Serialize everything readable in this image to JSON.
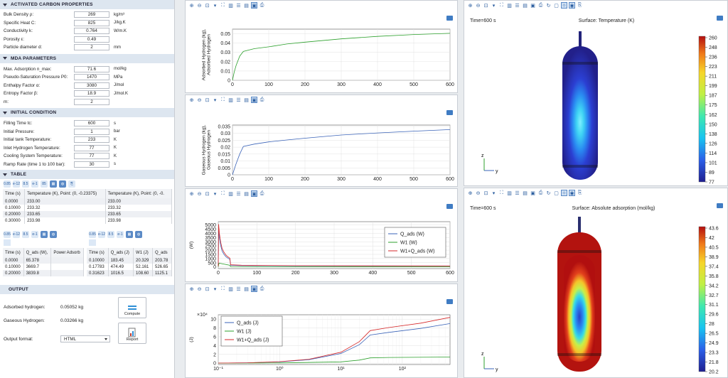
{
  "sections": {
    "carbon": {
      "title": "ACTIVATED CARBON PROPERTIES",
      "rows": [
        {
          "label": "Bulk Density ρ:",
          "value": "269",
          "unit": "kg/m³"
        },
        {
          "label": "Specific Heat C:",
          "value": "825",
          "unit": "J/kg.K"
        },
        {
          "label": "Conductivity k:",
          "value": "0.764",
          "unit": "W/m.K"
        },
        {
          "label": "Porosity ε:",
          "value": "0.49",
          "unit": ""
        },
        {
          "label": "Particle diameter d:",
          "value": "2",
          "unit": "mm"
        }
      ]
    },
    "mda": {
      "title": "MDA PARAMETERS",
      "rows": [
        {
          "label": "Max. Adsorption n_max:",
          "value": "71.6",
          "unit": "mol/kg"
        },
        {
          "label": "Pseudo-Saturation Pressure P0:",
          "value": "1470",
          "unit": "MPa"
        },
        {
          "label": "Enthalpy Factor α:",
          "value": "3080",
          "unit": "J/mol"
        },
        {
          "label": "Entropy Factor β:",
          "value": "18.9",
          "unit": "J/mol.K"
        },
        {
          "label": "m:",
          "value": "2",
          "unit": ""
        }
      ]
    },
    "initial": {
      "title": "INITIAL CONDITION",
      "rows": [
        {
          "label": "Filling Time tc:",
          "value": "600",
          "unit": "s"
        },
        {
          "label": "Initial Pressure:",
          "value": "1",
          "unit": "bar"
        },
        {
          "label": "Initial tank Temperature:",
          "value": "233",
          "unit": "K"
        },
        {
          "label": "Inlet Hydrogen Temperature:",
          "value": "77",
          "unit": "K"
        },
        {
          "label": "Cooling System Temperature:",
          "value": "77",
          "unit": "K"
        },
        {
          "label": "Ramp Rate (time 1 to 100 bar):",
          "value": "30",
          "unit": "s"
        }
      ]
    },
    "table": {
      "title": "TABLE"
    },
    "output": {
      "title": "OUTPUT"
    }
  },
  "table1": {
    "headers": [
      "Time (s)",
      "Temperature (K), Point: (0, -0.23375)",
      "Temperature (K), Point: (0, -0."
    ],
    "rows": [
      [
        "0.0000",
        "233.00",
        "233.00"
      ],
      [
        "0.10000",
        "233.32",
        "233.32"
      ],
      [
        "0.20000",
        "233.65",
        "233.65"
      ],
      [
        "0.30000",
        "233.98",
        "233.98"
      ]
    ]
  },
  "table2": {
    "headers": [
      "Time (s)",
      "Q_ads (W),",
      "Power Adsorb"
    ],
    "rows": [
      [
        "0.0000",
        "65.378",
        ""
      ],
      [
        "0.10000",
        "3669.7",
        ""
      ],
      [
        "0.20000",
        "3839.8",
        ""
      ]
    ]
  },
  "table3": {
    "headers": [
      "Time (s)",
      "Q_ads (J)",
      "W1 (J)",
      "Q_ads"
    ],
    "rows": [
      [
        "0.10000",
        "183.45",
        "20.329",
        "203.78"
      ],
      [
        "0.17783",
        "474.49",
        "52.161",
        "526.65"
      ],
      [
        "0.31623",
        "1016.5",
        "108.60",
        "1125.1"
      ]
    ]
  },
  "toolbar_glyphs": {
    "small_a": "0.85",
    "small_b": "e-12",
    "small_c": "8.5",
    "small_d": "e-1",
    "small_e": "85"
  },
  "output": {
    "adsorbed_label": "Adsorbed hydrogen:",
    "adsorbed_value": "0.05052 kg",
    "gaseous_label": "Gaseous Hydrogen:",
    "gaseous_value": "0.03266 kg",
    "compute_label": "Compute",
    "report_label": "Report",
    "format_label": "Output format:",
    "format_value": "HTML"
  },
  "chart_data": [
    {
      "type": "line",
      "ylabel": "Adsorbed Hydrogen (kg), Adsorbed Hydrogen",
      "xlim": [
        0,
        600
      ],
      "ylim": [
        0,
        0.055
      ],
      "xticks": [
        0,
        100,
        200,
        300,
        400,
        500,
        600
      ],
      "yticks": [
        0,
        0.01,
        0.02,
        0.03,
        0.04,
        0.05
      ],
      "series": [
        {
          "color": "#2ca02c",
          "x": [
            0,
            5,
            10,
            20,
            30,
            60,
            100,
            150,
            200,
            300,
            400,
            500,
            600
          ],
          "y": [
            0,
            0.009,
            0.016,
            0.026,
            0.031,
            0.034,
            0.036,
            0.039,
            0.041,
            0.0445,
            0.0472,
            0.0492,
            0.0505
          ]
        }
      ]
    },
    {
      "type": "line",
      "ylabel": "Gaseous Hydrogen (kg), Gaseous Hydrogen",
      "xlim": [
        0,
        600
      ],
      "ylim": [
        0,
        0.036
      ],
      "xticks": [
        0,
        100,
        200,
        300,
        400,
        500,
        600
      ],
      "yticks": [
        0,
        0.005,
        0.01,
        0.015,
        0.02,
        0.025,
        0.03,
        0.035
      ],
      "series": [
        {
          "color": "#3a63b8",
          "x": [
            0,
            5,
            10,
            20,
            30,
            60,
            100,
            150,
            200,
            300,
            400,
            500,
            600
          ],
          "y": [
            0,
            0.004,
            0.008,
            0.015,
            0.0205,
            0.0222,
            0.0238,
            0.0252,
            0.0265,
            0.0288,
            0.0303,
            0.0316,
            0.0327
          ]
        }
      ]
    },
    {
      "type": "line",
      "ylabel": "(W)",
      "xlim": [
        0,
        600
      ],
      "ylim": [
        -200,
        5400
      ],
      "xticks": [
        0,
        100,
        200,
        300,
        400,
        500,
        600
      ],
      "yticks": [
        0,
        500,
        1000,
        1500,
        2000,
        2500,
        3000,
        3500,
        4000,
        4500,
        5000
      ],
      "legend": "top-right",
      "series": [
        {
          "name": "Q_ads (W)",
          "color": "#3a63b8",
          "x": [
            0,
            1,
            3,
            6,
            10,
            15,
            20,
            25,
            30,
            32,
            60,
            200,
            600
          ],
          "y": [
            65,
            4300,
            3500,
            2600,
            1900,
            1500,
            1200,
            1050,
            900,
            200,
            160,
            120,
            100
          ]
        },
        {
          "name": "W1 (W)",
          "color": "#2ca02c",
          "x": [
            0,
            2,
            30,
            32,
            100,
            600
          ],
          "y": [
            0,
            450,
            200,
            20,
            10,
            5
          ]
        },
        {
          "name": "W1+Q_ads (W)",
          "color": "#d62728",
          "x": [
            0,
            1,
            3,
            6,
            10,
            15,
            20,
            25,
            30,
            32,
            60,
            200,
            600
          ],
          "y": [
            80,
            5100,
            4000,
            3000,
            2200,
            1750,
            1400,
            1200,
            1050,
            250,
            200,
            150,
            110
          ]
        }
      ]
    },
    {
      "type": "line",
      "ylabel": "(J)",
      "xscale": "log",
      "xlim": [
        0.1,
        600
      ],
      "ylim": [
        -0.3,
        11
      ],
      "xticks": [
        0.1,
        1,
        10,
        100
      ],
      "xtick_labels": [
        "10⁻¹",
        "10⁰",
        "10¹",
        "10²"
      ],
      "yticks": [
        0,
        2,
        4,
        6,
        8,
        10
      ],
      "y_multiplier": "×10⁴",
      "legend": "top-left",
      "series": [
        {
          "name": "Q_ads (J)",
          "color": "#3a63b8",
          "x": [
            0.1,
            0.3,
            1,
            3,
            10,
            20,
            30,
            60,
            200,
            600
          ],
          "y": [
            0.02,
            0.08,
            0.3,
            0.8,
            2.2,
            4.2,
            6.4,
            7.0,
            7.9,
            9.0
          ]
        },
        {
          "name": "W1 (J)",
          "color": "#2ca02c",
          "x": [
            0.1,
            1,
            10,
            20,
            30,
            60,
            600
          ],
          "y": [
            0,
            0.05,
            0.3,
            0.7,
            1.2,
            1.3,
            1.4
          ]
        },
        {
          "name": "W1+Q_ads (J)",
          "color": "#d62728",
          "x": [
            0.1,
            0.3,
            1,
            3,
            10,
            20,
            30,
            60,
            200,
            600
          ],
          "y": [
            0.02,
            0.09,
            0.35,
            0.9,
            2.5,
            4.9,
            7.4,
            8.1,
            9.1,
            10.4
          ]
        }
      ]
    }
  ],
  "surface_temp": {
    "time": "Time=600 s",
    "title": "Surface: Temperature (K)",
    "colorbar": [
      "260",
      "248",
      "236",
      "223",
      "211",
      "199",
      "187",
      "175",
      "162",
      "150",
      "138",
      "126",
      "114",
      "101",
      "89",
      "77"
    ],
    "axis_z": "z",
    "axis_y": "y"
  },
  "surface_ads": {
    "time": "Time=600 s",
    "title": "Surface: Absolute adsorption (mol/kg)",
    "colorbar": [
      "43.6",
      "42",
      "40.5",
      "38.9",
      "37.4",
      "35.8",
      "34.2",
      "32.7",
      "31.1",
      "29.6",
      "28",
      "26.5",
      "24.9",
      "23.3",
      "21.8",
      "20.2"
    ],
    "axis_z": "z",
    "axis_y": "y"
  }
}
